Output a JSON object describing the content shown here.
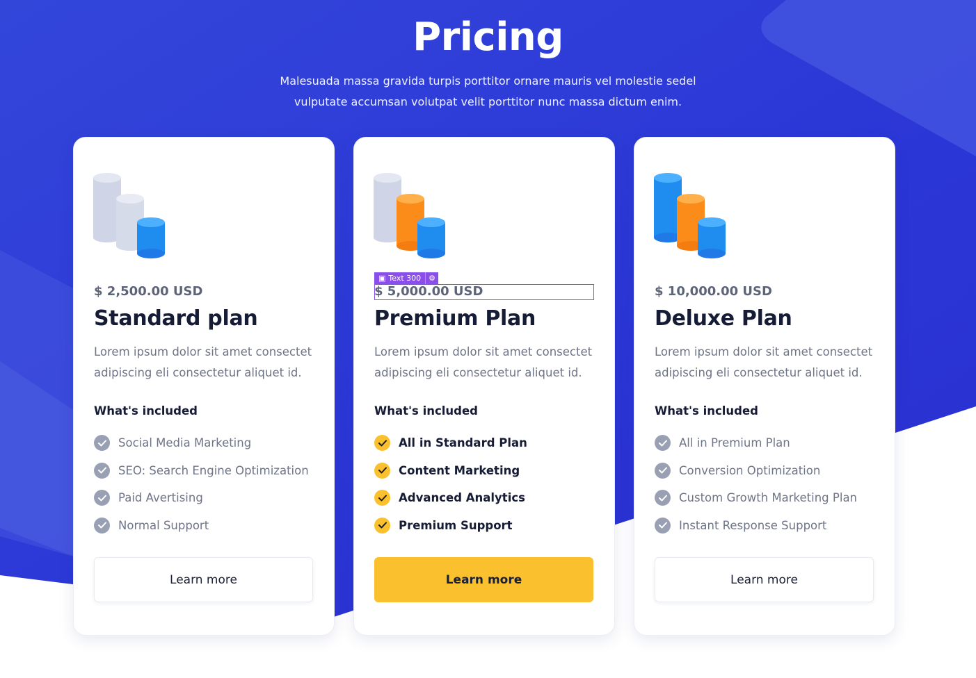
{
  "hero": {
    "title": "Pricing",
    "subtitle_line1": "Malesuada massa gravida turpis porttitor ornare mauris vel molestie sedel",
    "subtitle_line2": "vulputate accumsan volutpat velit porttitor nunc massa dictum enim."
  },
  "colors": {
    "hero_blue": "#2f3bd8",
    "accent_yellow": "#fbc02d",
    "accent_orange": "#fb8c1a",
    "cylinder_blue": "#2196f3",
    "cylinder_grey": "#cfd5e6",
    "editor_purple": "#8a4fe8"
  },
  "editor": {
    "tag_label": "Text 300",
    "tag_icon": "text-block-icon",
    "gear_icon": "gear-icon"
  },
  "plans": [
    {
      "price": "$ 2,500.00 USD",
      "name": "Standard plan",
      "description": "Lorem ipsum dolor sit amet consectet adipiscing eli consectetur aliquet id.",
      "included_label": "What's included",
      "features": [
        "Social Media Marketing",
        "SEO: Search Engine Optimization",
        "Paid Avertising",
        "Normal Support"
      ],
      "button": "Learn more",
      "illustration": "cylinders-tier-1"
    },
    {
      "price": "$ 5,000.00 USD",
      "name": "Premium Plan",
      "description": "Lorem ipsum dolor sit amet consectet adipiscing eli consectetur aliquet id.",
      "included_label": "What's included",
      "features": [
        "All in Standard Plan",
        "Content Marketing",
        "Advanced Analytics",
        "Premium Support"
      ],
      "button": "Learn more",
      "illustration": "cylinders-tier-2"
    },
    {
      "price": "$ 10,000.00 USD",
      "name": "Deluxe Plan",
      "description": "Lorem ipsum dolor sit amet consectet adipiscing eli consectetur aliquet id.",
      "included_label": "What's included",
      "features": [
        "All in Premium Plan",
        "Conversion Optimization",
        "Custom Growth Marketing Plan",
        "Instant Response Support"
      ],
      "button": "Learn more",
      "illustration": "cylinders-tier-3"
    }
  ]
}
